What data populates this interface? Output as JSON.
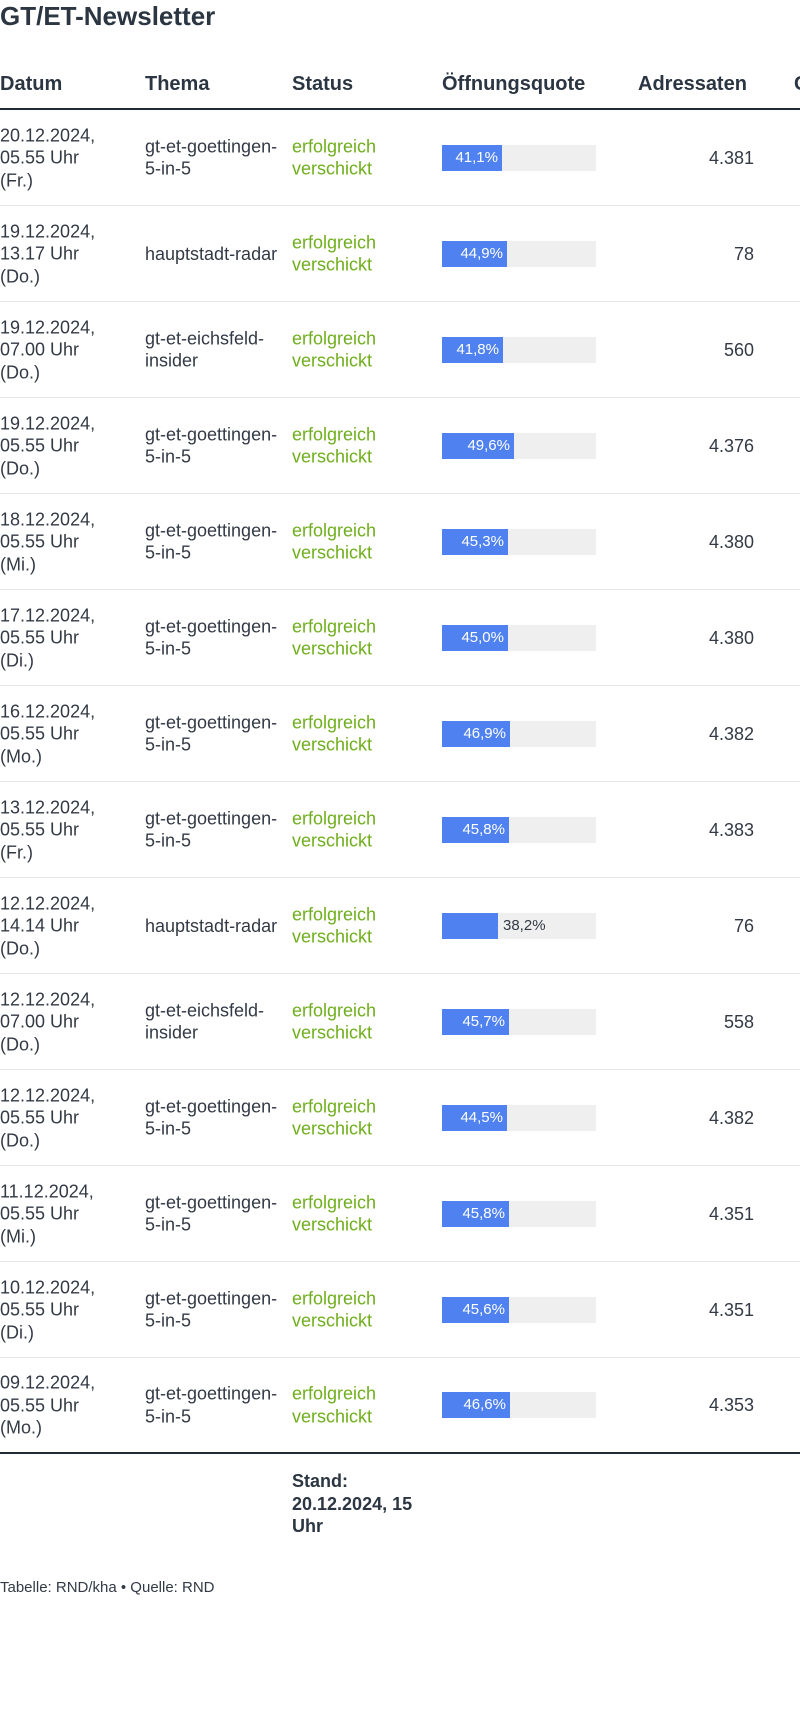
{
  "title": "GT/ET-Newsletter",
  "columns": {
    "date": "Datum",
    "theme": "Thema",
    "status": "Status",
    "open_rate": "Öffnungsquote",
    "recipients": "Adressaten",
    "extra": "C"
  },
  "rows": [
    {
      "date": "20.12.2024,\n05.55 Uhr\n(Fr.)",
      "theme": "gt-et-goettingen-5-in-5",
      "status": "erfolgreich verschickt",
      "rate_label": "41,1%",
      "rate": 41.1,
      "recipients": "4.381"
    },
    {
      "date": "19.12.2024,\n13.17 Uhr\n(Do.)",
      "theme": "hauptstadt-radar",
      "status": "erfolgreich verschickt",
      "rate_label": "44,9%",
      "rate": 44.9,
      "recipients": "78"
    },
    {
      "date": "19.12.2024,\n07.00 Uhr\n(Do.)",
      "theme": "gt-et-eichsfeld-insider",
      "status": "erfolgreich verschickt",
      "rate_label": "41,8%",
      "rate": 41.8,
      "recipients": "560"
    },
    {
      "date": "19.12.2024,\n05.55 Uhr\n(Do.)",
      "theme": "gt-et-goettingen-5-in-5",
      "status": "erfolgreich verschickt",
      "rate_label": "49,6%",
      "rate": 49.6,
      "recipients": "4.376"
    },
    {
      "date": "18.12.2024,\n05.55 Uhr\n(Mi.)",
      "theme": "gt-et-goettingen-5-in-5",
      "status": "erfolgreich verschickt",
      "rate_label": "45,3%",
      "rate": 45.3,
      "recipients": "4.380"
    },
    {
      "date": "17.12.2024,\n05.55 Uhr\n(Di.)",
      "theme": "gt-et-goettingen-5-in-5",
      "status": "erfolgreich verschickt",
      "rate_label": "45,0%",
      "rate": 45.0,
      "recipients": "4.380"
    },
    {
      "date": "16.12.2024,\n05.55 Uhr\n(Mo.)",
      "theme": "gt-et-goettingen-5-in-5",
      "status": "erfolgreich verschickt",
      "rate_label": "46,9%",
      "rate": 46.9,
      "recipients": "4.382"
    },
    {
      "date": "13.12.2024,\n05.55 Uhr\n(Fr.)",
      "theme": "gt-et-goettingen-5-in-5",
      "status": "erfolgreich verschickt",
      "rate_label": "45,8%",
      "rate": 45.8,
      "recipients": "4.383"
    },
    {
      "date": "12.12.2024,\n14.14 Uhr\n(Do.)",
      "theme": "hauptstadt-radar",
      "status": "erfolgreich verschickt",
      "rate_label": "38,2%",
      "rate": 38.2,
      "recipients": "76"
    },
    {
      "date": "12.12.2024,\n07.00 Uhr\n(Do.)",
      "theme": "gt-et-eichsfeld-insider",
      "status": "erfolgreich verschickt",
      "rate_label": "45,7%",
      "rate": 45.7,
      "recipients": "558"
    },
    {
      "date": "12.12.2024,\n05.55 Uhr\n(Do.)",
      "theme": "gt-et-goettingen-5-in-5",
      "status": "erfolgreich verschickt",
      "rate_label": "44,5%",
      "rate": 44.5,
      "recipients": "4.382"
    },
    {
      "date": "11.12.2024,\n05.55 Uhr\n(Mi.)",
      "theme": "gt-et-goettingen-5-in-5",
      "status": "erfolgreich verschickt",
      "rate_label": "45,8%",
      "rate": 45.8,
      "recipients": "4.351"
    },
    {
      "date": "10.12.2024,\n05.55 Uhr\n(Di.)",
      "theme": "gt-et-goettingen-5-in-5",
      "status": "erfolgreich verschickt",
      "rate_label": "45,6%",
      "rate": 45.6,
      "recipients": "4.351"
    },
    {
      "date": "09.12.2024,\n05.55 Uhr\n(Mo.)",
      "theme": "gt-et-goettingen-5-in-5",
      "status": "erfolgreich verschickt",
      "rate_label": "46,6%",
      "rate": 46.6,
      "recipients": "4.353"
    }
  ],
  "stand": "Stand: 20.12.2024, 15 Uhr",
  "source": "Tabelle: RND/kha • Quelle: RND",
  "colors": {
    "bar": "#4f82f0",
    "bar_track": "#efefef",
    "status": "#6fae1c",
    "heading": "#2b3642"
  }
}
